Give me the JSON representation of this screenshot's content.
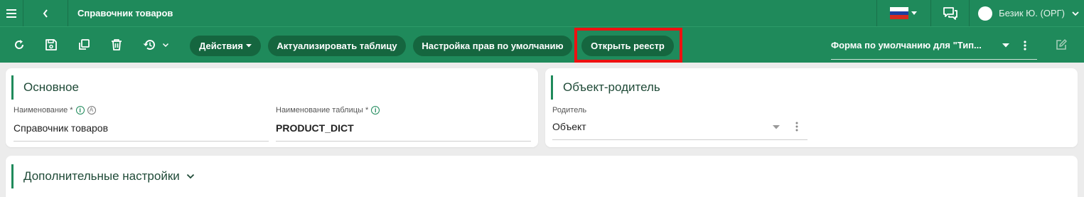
{
  "topbar": {
    "title": "Справочник товаров",
    "user_name": "Безик Ю. (ОРГ)",
    "flag_colors": [
      "#ffffff",
      "#1c3fa0",
      "#d52b1e"
    ]
  },
  "toolbar": {
    "actions_label": "Действия",
    "refresh_table_label": "Актуализировать таблицу",
    "default_rights_label": "Настройка прав по умолчанию",
    "open_registry_label": "Открыть реестр",
    "form_select_value": "Форма по умолчанию для \"Тип..."
  },
  "main_card": {
    "title": "Основное",
    "name_label": "Наименование *",
    "name_value": "Справочник товаров",
    "table_name_label": "Наименование таблицы *",
    "table_name_value": "PRODUCT_DICT"
  },
  "parent_card": {
    "title": "Объект-родитель",
    "parent_label": "Родитель",
    "parent_value": "Объект"
  },
  "extra_card": {
    "title": "Дополнительные настройки"
  },
  "colors": {
    "brand_green": "#1f8a5b",
    "pill_green": "#15663f",
    "highlight_red": "#ee1111"
  }
}
